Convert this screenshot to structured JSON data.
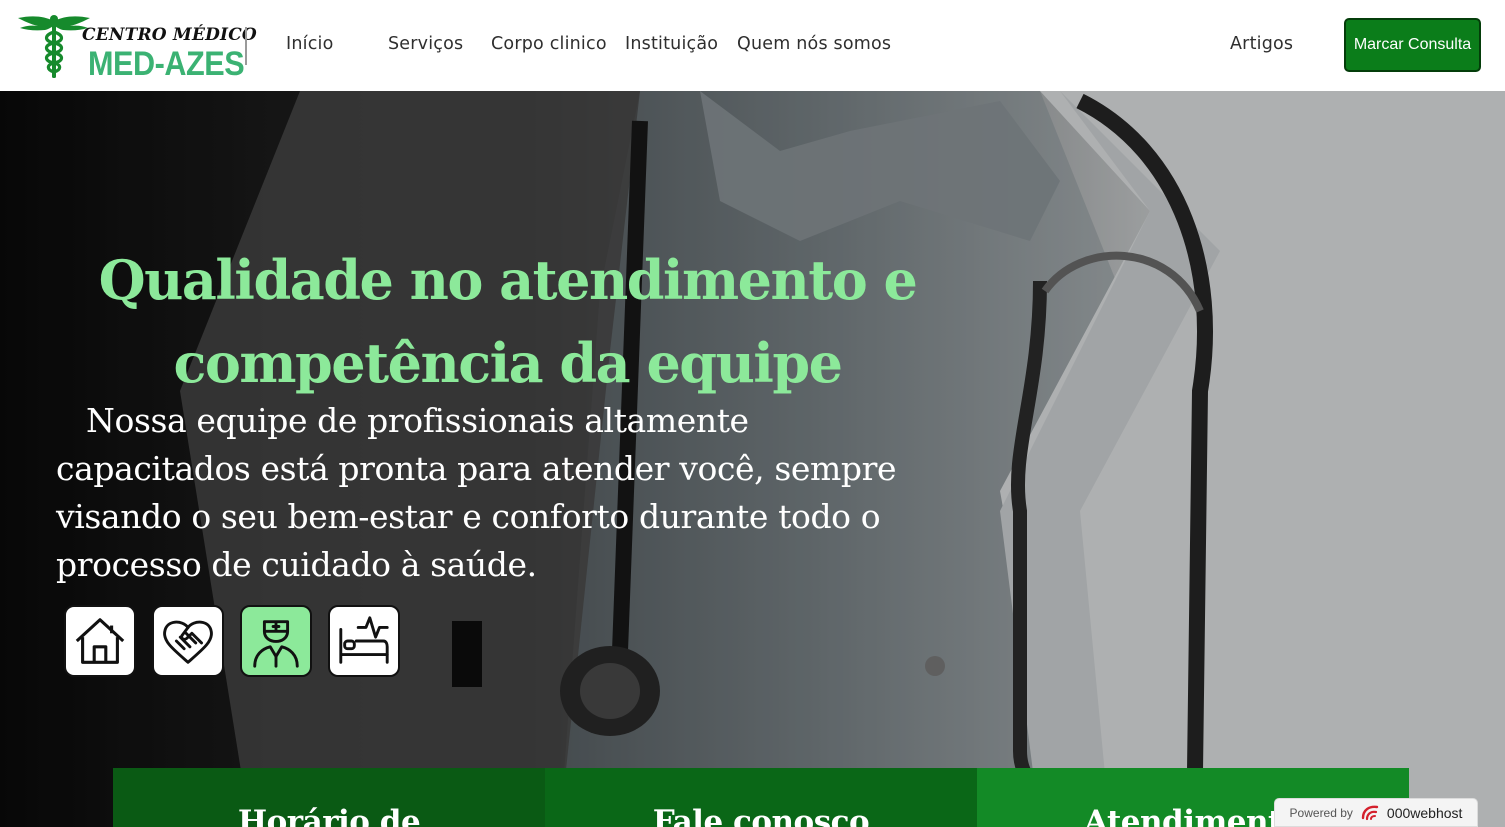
{
  "header": {
    "logo_top": "CENTRO MÉDICO",
    "logo_main": "MED-AZES",
    "nav": [
      {
        "label": "Início"
      },
      {
        "label": "Serviços"
      },
      {
        "label": "Corpo clinico"
      },
      {
        "label": "Instituição"
      },
      {
        "label": "Quem nós somos"
      },
      {
        "label": "Artigos"
      }
    ],
    "cta_label": "Marcar Consulta"
  },
  "hero": {
    "title": "Qualidade no atendimento e competência da equipe",
    "text": "Nossa equipe de profissionais altamente capacitados está pronta para atender você, sempre visando o seu bem-estar e conforto durante todo o processo de cuidado à saúde.",
    "icons": [
      "home-icon",
      "handshake-heart-icon",
      "nurse-icon",
      "hospital-bed-icon"
    ],
    "active_icon": "nurse-icon"
  },
  "cards": [
    {
      "label": "Horário de"
    },
    {
      "label": "Fale conosco"
    },
    {
      "label": "Atendimento"
    }
  ],
  "footer_badge": {
    "powered": "Powered by",
    "brand": "000webhost"
  },
  "colors": {
    "brand_green": "#3bb273",
    "title_green": "#8ce99a",
    "cta_green": "#0b7d1a",
    "card_dark": "#0a5a14",
    "card_mid": "#0a6717",
    "card_light": "#138a26"
  }
}
